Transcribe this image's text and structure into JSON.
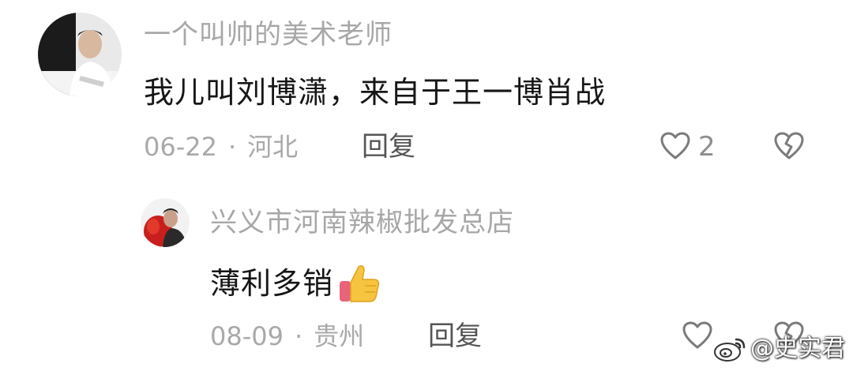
{
  "comments": [
    {
      "username": "一个叫帅的美术老师",
      "text": "我儿叫刘博潇，来自于王一博肖战",
      "date": "06-22",
      "separator": "·",
      "location": "河北",
      "reply_label": "回复",
      "like_count": "2",
      "avatar_icon": "avatar-photo",
      "like_icon": "heart-outline-icon",
      "dislike_icon": "broken-heart-icon"
    },
    {
      "username": "兴义市河南辣椒批发总店",
      "text": "薄利多销",
      "emoji": "thumbs-up-icon",
      "date": "08-09",
      "separator": "·",
      "location": "贵州",
      "reply_label": "回复",
      "avatar_icon": "avatar-photo",
      "like_icon": "heart-outline-icon",
      "dislike_icon": "broken-heart-icon"
    }
  ],
  "watermark": {
    "icon": "weibo-icon",
    "text": "@史实君"
  },
  "colors": {
    "username": "#a7a7a7",
    "text": "#161616",
    "meta": "#a9a9a9",
    "reply": "#555555",
    "icon": "#7a7a7a",
    "background": "#ffffff"
  }
}
